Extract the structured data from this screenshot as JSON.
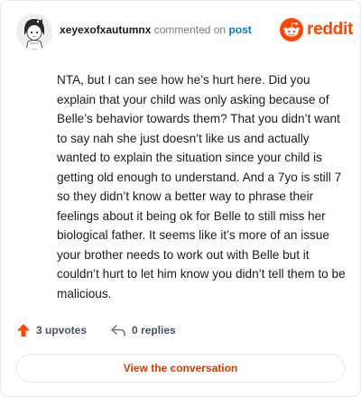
{
  "header": {
    "username": "xeyexofxautumnx",
    "action_text": "commented on",
    "post_link": "post"
  },
  "brand": {
    "wordmark": "reddit",
    "icon": "reddit-snoo-icon",
    "color": "#ff4500"
  },
  "comment": {
    "body": "NTA, but I can see how he’s hurt here. Did you explain that your child was only asking because of Belle’s behavior towards them? That you didn’t want to say nah she just doesn’t like us and actually wanted to explain the situation since your child is getting old enough to understand. And a 7yo is still 7 so they didn’t know a better way to phrase their feelings about it being ok for Belle to still miss her biological father. It seems like it’s more of an issue your brother needs to work out with Belle but it couldn’t hurt to let him know you didn’t tell them to be malicious."
  },
  "actions": {
    "upvotes": "3 upvotes",
    "upvote_icon": "upvote-arrow-icon",
    "replies": "0 replies",
    "reply_icon": "reply-arrow-icon"
  },
  "footer": {
    "button_label": "View the conversation"
  },
  "colors": {
    "accent": "#ff4500",
    "link": "#0079d3",
    "button_text": "#d93a00"
  }
}
